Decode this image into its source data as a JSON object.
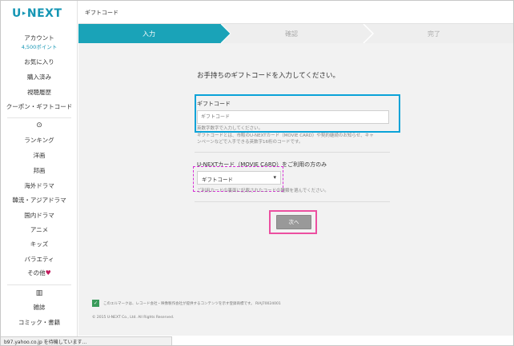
{
  "brand": {
    "logo_left": "U",
    "logo_dot": "▸",
    "logo_right": "NEXT",
    "color": "#1596b4"
  },
  "header": {
    "title": "ギフトコード"
  },
  "sidebar": {
    "account": {
      "label": "アカウント",
      "points": "4,500ポイント"
    },
    "items": [
      {
        "label": "お気に入り"
      },
      {
        "label": "購入済み"
      },
      {
        "label": "視聴履歴"
      },
      {
        "label": "クーポン・ギフトコード"
      }
    ],
    "video_icon": "⊙",
    "video_items": [
      {
        "label": "ランキング"
      },
      {
        "label": "洋画"
      },
      {
        "label": "邦画"
      },
      {
        "label": "海外ドラマ"
      },
      {
        "label": "韓流・アジアドラマ"
      },
      {
        "label": "国内ドラマ"
      },
      {
        "label": "アニメ"
      },
      {
        "label": "キッズ"
      },
      {
        "label": "バラエティ"
      },
      {
        "label": "その他"
      }
    ],
    "other_heart": "♥",
    "book_icon": "▥",
    "book_items": [
      {
        "label": "雑誌"
      },
      {
        "label": "コミック・書籍"
      }
    ]
  },
  "steps": [
    {
      "label": "入力",
      "active": true
    },
    {
      "label": "確認",
      "active": false
    },
    {
      "label": "完了",
      "active": false
    }
  ],
  "colors": {
    "step_active": "#1aa3b8",
    "step_inactive": "#eeeeee",
    "highlight_blue": "#0aa3d8",
    "highlight_pink": "#ec4fa0",
    "highlight_magenta": "#d62fd6"
  },
  "form": {
    "title": "お手持ちのギフトコードを入力してください。",
    "gift_code_label": "ギフトコード",
    "gift_code_placeholder": "ギフトコード",
    "gift_code_hint1": "英数字数字で入力してください。",
    "gift_code_hint2": "ギフトコードとは、市販のU-NEXTカード（MOVIE CARD）や契約継続のお知らせ、キャ",
    "gift_code_hint3": "ンペーンなどで入手できる英数字16桁のコードです。",
    "card_label": "U-NEXTカード（MOVIE CARD）をご利用の方のみ",
    "code_type_value": "ギフトコード",
    "code_type_caret": "▾",
    "code_type_hint": "ご利用カードの裏面に記載されたコードの種類を選んでください。",
    "next_button": "次へ"
  },
  "footer": {
    "mark_icon": "✓",
    "mark_text": "このエルマークは、レコード会社・映像製作会社が提供するコンテンツを示す登録商標です。 RIAJ70024001",
    "copyright": "© 2015 U-NEXT Co., Ltd. All Rights Reserved."
  },
  "status_bar": {
    "text": "b97.yahoo.co.jp を待機しています..."
  }
}
